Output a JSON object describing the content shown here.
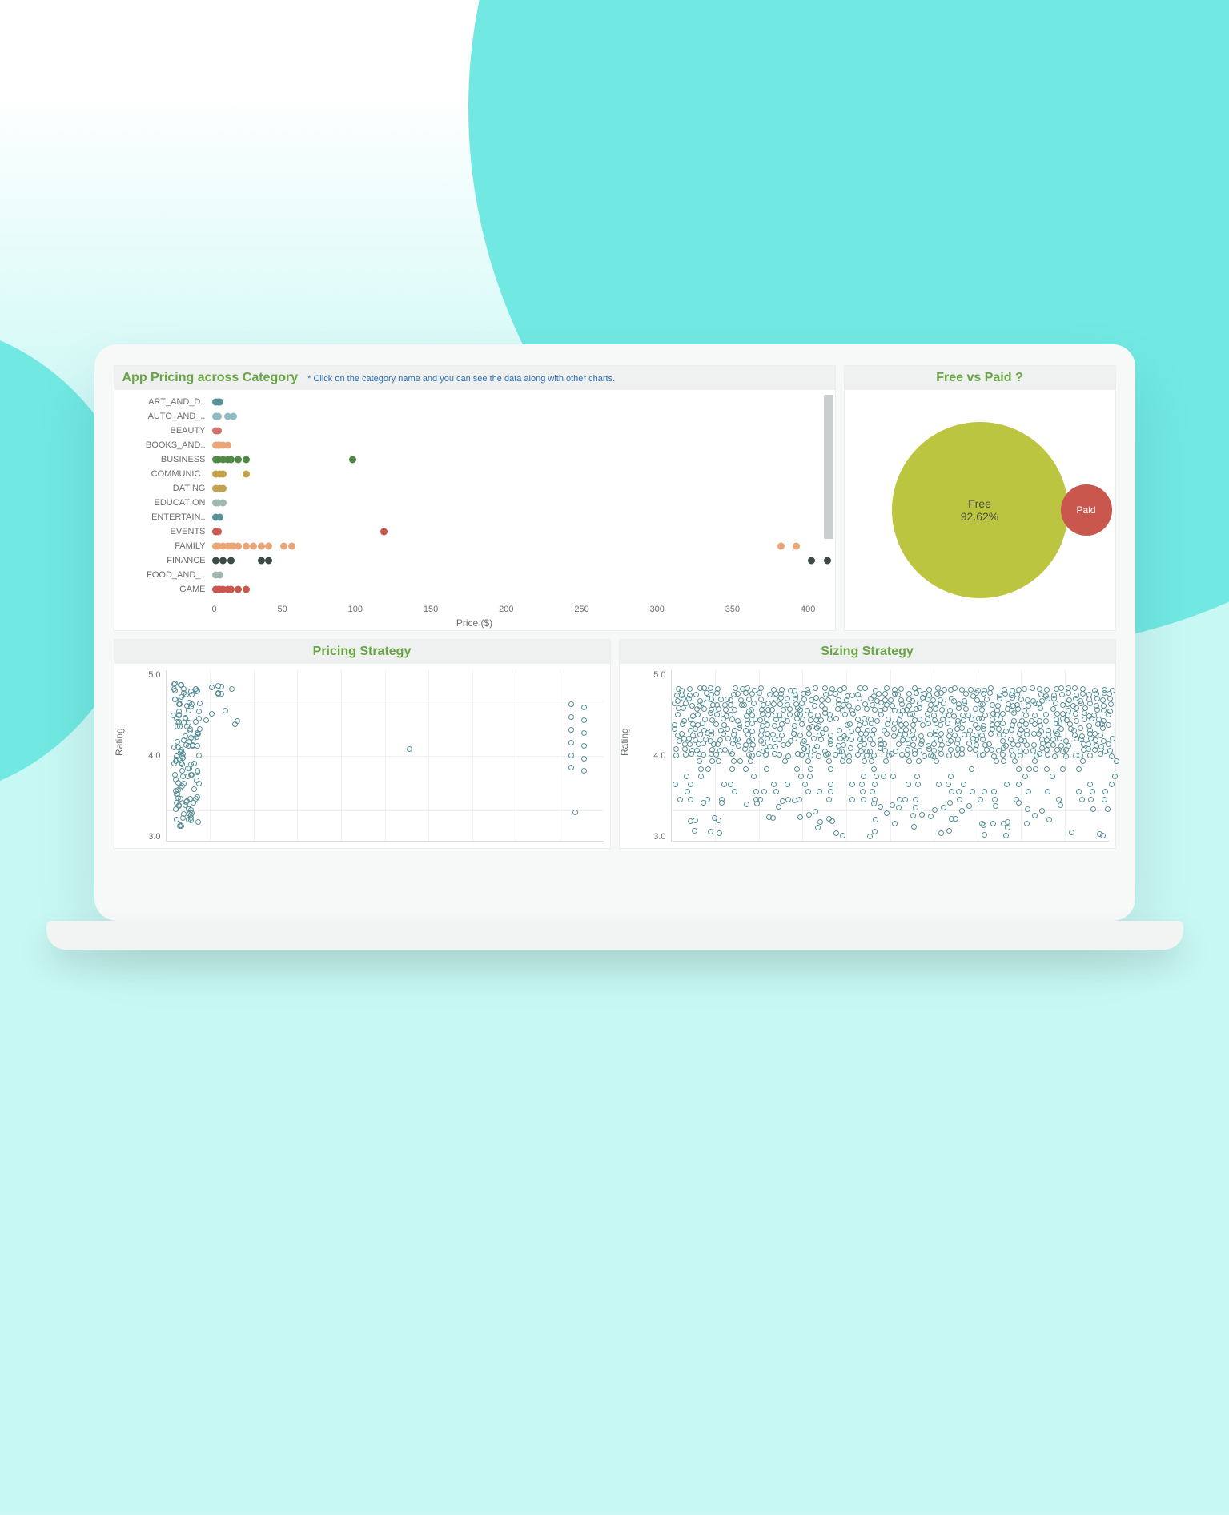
{
  "panels": {
    "pricing": {
      "title": "App Pricing across Category",
      "hint": "* Click on the category name and you can see the data along with other charts.",
      "xlabel": "Price ($)"
    },
    "pie": {
      "title": "Free vs Paid ?",
      "free_label": "Free",
      "free_pct": "92.62%",
      "paid_label": "Paid"
    },
    "pricing_strategy": {
      "title": "Pricing Strategy",
      "ylabel": "Rating"
    },
    "sizing_strategy": {
      "title": "Sizing Strategy",
      "ylabel": "Rating"
    }
  },
  "chart_data": [
    {
      "id": "pricing_across_category",
      "type": "scatter",
      "xlabel": "Price ($)",
      "xlim": [
        0,
        400
      ],
      "xticks": [
        0,
        50,
        100,
        150,
        200,
        250,
        300,
        350,
        400
      ],
      "categories": [
        {
          "name": "ART_AND_D..",
          "color": "#5a8f97",
          "x": [
            0,
            2,
            3
          ]
        },
        {
          "name": "AUTO_AND_..",
          "color": "#8fb9c3",
          "x": [
            0,
            2,
            8,
            12
          ]
        },
        {
          "name": "BEAUTY",
          "color": "#d0736a",
          "x": [
            0,
            2
          ]
        },
        {
          "name": "BOOKS_AND..",
          "color": "#e7a77b",
          "x": [
            0,
            2,
            3,
            5,
            8
          ]
        },
        {
          "name": "BUSINESS",
          "color": "#4f8a43",
          "x": [
            0,
            2,
            5,
            8,
            10,
            15,
            20,
            90
          ]
        },
        {
          "name": "COMMUNIC..",
          "color": "#c2a24b",
          "x": [
            0,
            3,
            5,
            20
          ]
        },
        {
          "name": "DATING",
          "color": "#c2a24b",
          "x": [
            0,
            3,
            5
          ]
        },
        {
          "name": "EDUCATION",
          "color": "#9fb7b2",
          "x": [
            0,
            2,
            5
          ]
        },
        {
          "name": "ENTERTAIN..",
          "color": "#5a8f97",
          "x": [
            0,
            3
          ]
        },
        {
          "name": "EVENTS",
          "color": "#c9574e",
          "x": [
            0,
            2,
            110
          ]
        },
        {
          "name": "FAMILY",
          "color": "#e7a77b",
          "x": [
            0,
            2,
            5,
            8,
            10,
            12,
            15,
            20,
            25,
            30,
            35,
            45,
            50,
            370,
            380
          ]
        },
        {
          "name": "FINANCE",
          "color": "#3e4a47",
          "x": [
            0,
            5,
            10,
            30,
            35,
            390,
            400
          ]
        },
        {
          "name": "FOOD_AND_..",
          "color": "#9fb7b2",
          "x": [
            0,
            3
          ]
        },
        {
          "name": "GAME",
          "color": "#c9574e",
          "x": [
            0,
            2,
            3,
            5,
            8,
            10,
            15,
            20
          ]
        }
      ]
    },
    {
      "id": "free_vs_paid",
      "type": "pie",
      "title": "Free vs Paid ?",
      "slices": [
        {
          "label": "Free",
          "value": 92.62,
          "color": "#bcc540"
        },
        {
          "label": "Paid",
          "value": 7.38,
          "color": "#c9574e"
        }
      ]
    },
    {
      "id": "pricing_strategy",
      "type": "scatter",
      "ylabel": "Rating",
      "ylim": [
        2.5,
        5.2
      ],
      "yticks": [
        5.0,
        4.0,
        3.0
      ],
      "note": "x ≈ Price; points cluster near x≈0 across ratings 2.8–5.0 with a smaller group near the right edge at ratings 3.6–4.7 and a lone point near mid-x at ~4.0"
    },
    {
      "id": "sizing_strategy",
      "type": "scatter",
      "ylabel": "Rating",
      "ylim": [
        2.5,
        5.2
      ],
      "yticks": [
        5.0,
        4.0,
        3.0
      ],
      "note": "x ≈ Size; extremely dense cloud, ratings skew high (4.0–5.0) across the full x range with sparser tail below 3.5"
    }
  ]
}
